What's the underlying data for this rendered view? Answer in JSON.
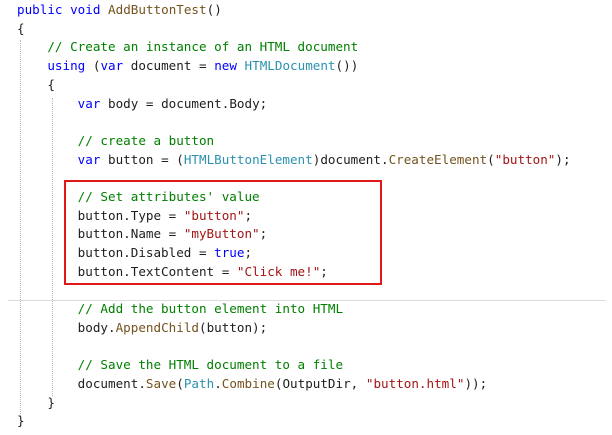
{
  "code": {
    "lines": [
      {
        "tokens": [
          {
            "text": "public",
            "kind": "keyword"
          },
          {
            "text": " ",
            "kind": "plain"
          },
          {
            "text": "void",
            "kind": "keyword"
          },
          {
            "text": " ",
            "kind": "plain"
          },
          {
            "text": "AddButtonTest",
            "kind": "method"
          },
          {
            "text": "()",
            "kind": "plain"
          }
        ]
      },
      {
        "tokens": [
          {
            "text": "{",
            "kind": "plain"
          }
        ]
      },
      {
        "tokens": [
          {
            "text": "    // Create an instance of an HTML document",
            "kind": "comment"
          }
        ]
      },
      {
        "tokens": [
          {
            "text": "    ",
            "kind": "plain"
          },
          {
            "text": "using",
            "kind": "keyword"
          },
          {
            "text": " (",
            "kind": "plain"
          },
          {
            "text": "var",
            "kind": "keyword"
          },
          {
            "text": " document = ",
            "kind": "plain"
          },
          {
            "text": "new",
            "kind": "keyword"
          },
          {
            "text": " ",
            "kind": "plain"
          },
          {
            "text": "HTMLDocument",
            "kind": "type"
          },
          {
            "text": "())",
            "kind": "plain"
          }
        ]
      },
      {
        "tokens": [
          {
            "text": "    {",
            "kind": "plain"
          }
        ]
      },
      {
        "tokens": [
          {
            "text": "        ",
            "kind": "plain"
          },
          {
            "text": "var",
            "kind": "keyword"
          },
          {
            "text": " body = document.Body;",
            "kind": "plain"
          }
        ]
      },
      {
        "tokens": []
      },
      {
        "tokens": [
          {
            "text": "        // create a button",
            "kind": "comment"
          }
        ]
      },
      {
        "tokens": [
          {
            "text": "        ",
            "kind": "plain"
          },
          {
            "text": "var",
            "kind": "keyword"
          },
          {
            "text": " button = (",
            "kind": "plain"
          },
          {
            "text": "HTMLButtonElement",
            "kind": "type"
          },
          {
            "text": ")document.",
            "kind": "plain"
          },
          {
            "text": "CreateElement",
            "kind": "method"
          },
          {
            "text": "(",
            "kind": "plain"
          },
          {
            "text": "\"button\"",
            "kind": "string"
          },
          {
            "text": ");",
            "kind": "plain"
          }
        ]
      },
      {
        "tokens": []
      },
      {
        "tokens": [
          {
            "text": "        // Set attributes' value",
            "kind": "comment"
          }
        ]
      },
      {
        "tokens": [
          {
            "text": "        button.Type = ",
            "kind": "plain"
          },
          {
            "text": "\"button\"",
            "kind": "string"
          },
          {
            "text": ";",
            "kind": "plain"
          }
        ]
      },
      {
        "tokens": [
          {
            "text": "        button.Name = ",
            "kind": "plain"
          },
          {
            "text": "\"myButton\"",
            "kind": "string"
          },
          {
            "text": ";",
            "kind": "plain"
          }
        ]
      },
      {
        "tokens": [
          {
            "text": "        button.Disabled = ",
            "kind": "plain"
          },
          {
            "text": "true",
            "kind": "keyword"
          },
          {
            "text": ";",
            "kind": "plain"
          }
        ]
      },
      {
        "tokens": [
          {
            "text": "        button.TextContent = ",
            "kind": "plain"
          },
          {
            "text": "\"Click me!\"",
            "kind": "string"
          },
          {
            "text": ";",
            "kind": "plain"
          }
        ]
      },
      {
        "tokens": []
      },
      {
        "tokens": [
          {
            "text": "        // Add the button element into HTML",
            "kind": "comment"
          }
        ]
      },
      {
        "tokens": [
          {
            "text": "        body.",
            "kind": "plain"
          },
          {
            "text": "AppendChild",
            "kind": "method"
          },
          {
            "text": "(button);",
            "kind": "plain"
          }
        ]
      },
      {
        "tokens": []
      },
      {
        "tokens": [
          {
            "text": "        // Save the HTML document to a file",
            "kind": "comment"
          }
        ]
      },
      {
        "tokens": [
          {
            "text": "        document.",
            "kind": "plain"
          },
          {
            "text": "Save",
            "kind": "method"
          },
          {
            "text": "(",
            "kind": "plain"
          },
          {
            "text": "Path",
            "kind": "type"
          },
          {
            "text": ".",
            "kind": "plain"
          },
          {
            "text": "Combine",
            "kind": "method"
          },
          {
            "text": "(OutputDir, ",
            "kind": "plain"
          },
          {
            "text": "\"button.html\"",
            "kind": "string"
          },
          {
            "text": "));",
            "kind": "plain"
          }
        ]
      },
      {
        "tokens": [
          {
            "text": "    }",
            "kind": "plain"
          }
        ]
      },
      {
        "tokens": [
          {
            "text": "}",
            "kind": "plain"
          }
        ]
      }
    ]
  },
  "colors": {
    "keyword": "#0000ff",
    "type": "#2b91af",
    "method": "#74531f",
    "string": "#a31515",
    "comment": "#008000",
    "plain": "#1e1e1e",
    "highlight_border": "#e01818"
  }
}
